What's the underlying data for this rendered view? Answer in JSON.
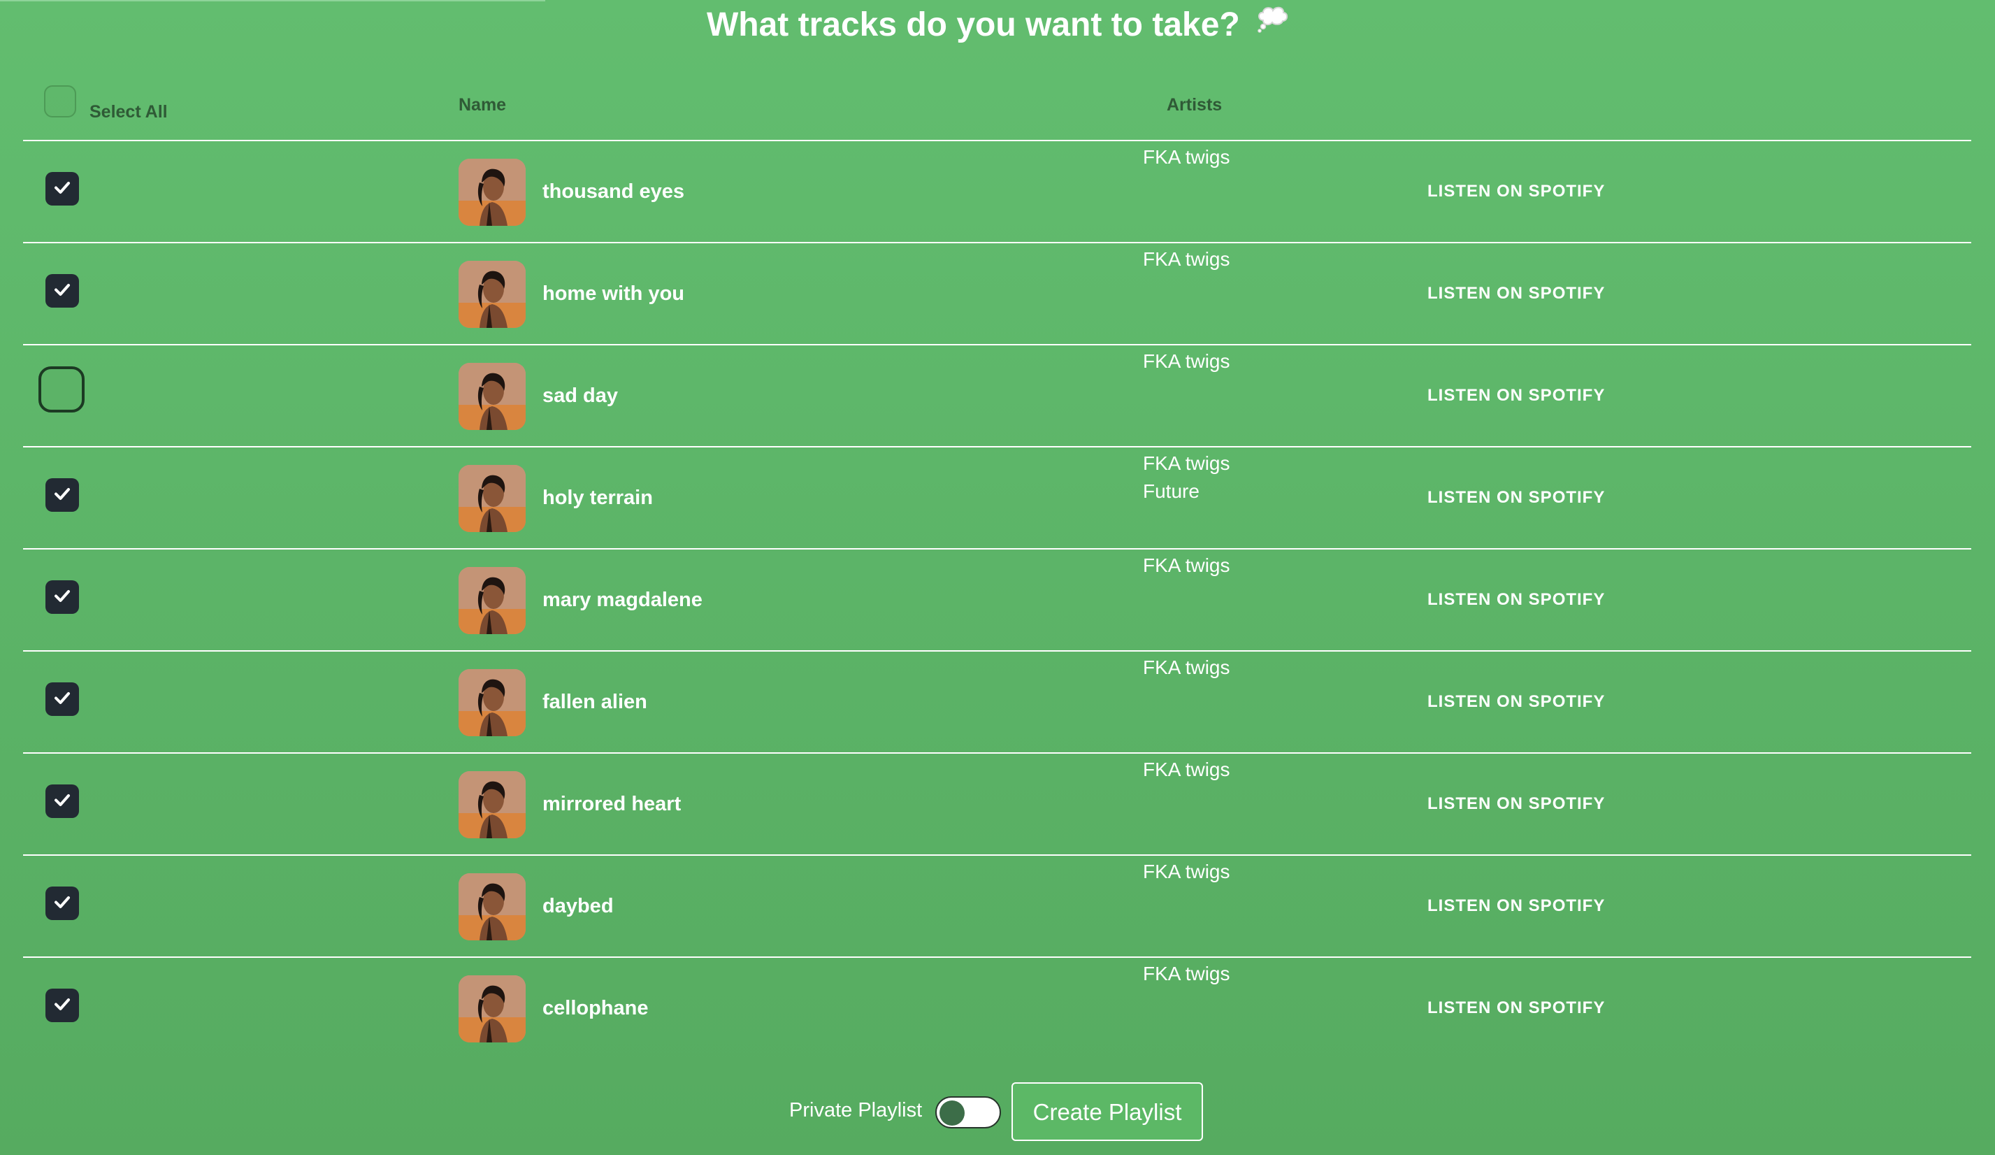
{
  "page": {
    "title": "What tracks do you want to take?",
    "title_icon": "thought-balloon-icon"
  },
  "table": {
    "headers": {
      "select_all": "Select All",
      "name": "Name",
      "artists": "Artists"
    },
    "select_all_checked": false,
    "listen_label": "LISTEN ON SPOTIFY",
    "rows": [
      {
        "name": "thousand eyes",
        "artists": [
          "FKA twigs"
        ],
        "checked": true
      },
      {
        "name": "home with you",
        "artists": [
          "FKA twigs"
        ],
        "checked": true
      },
      {
        "name": "sad day",
        "artists": [
          "FKA twigs"
        ],
        "checked": false
      },
      {
        "name": "holy terrain",
        "artists": [
          "FKA twigs",
          "Future"
        ],
        "checked": true
      },
      {
        "name": "mary magdalene",
        "artists": [
          "FKA twigs"
        ],
        "checked": true
      },
      {
        "name": "fallen alien",
        "artists": [
          "FKA twigs"
        ],
        "checked": true
      },
      {
        "name": "mirrored heart",
        "artists": [
          "FKA twigs"
        ],
        "checked": true
      },
      {
        "name": "daybed",
        "artists": [
          "FKA twigs"
        ],
        "checked": true
      },
      {
        "name": "cellophane",
        "artists": [
          "FKA twigs"
        ],
        "checked": true
      }
    ]
  },
  "footer": {
    "private_label": "Private Playlist",
    "private_enabled": false,
    "create_label": "Create Playlist"
  },
  "colors": {
    "background_top": "#62bd6f",
    "background_bottom": "#56ab60",
    "checkbox_checked": "#222a33",
    "header_text": "#2f5a36"
  }
}
